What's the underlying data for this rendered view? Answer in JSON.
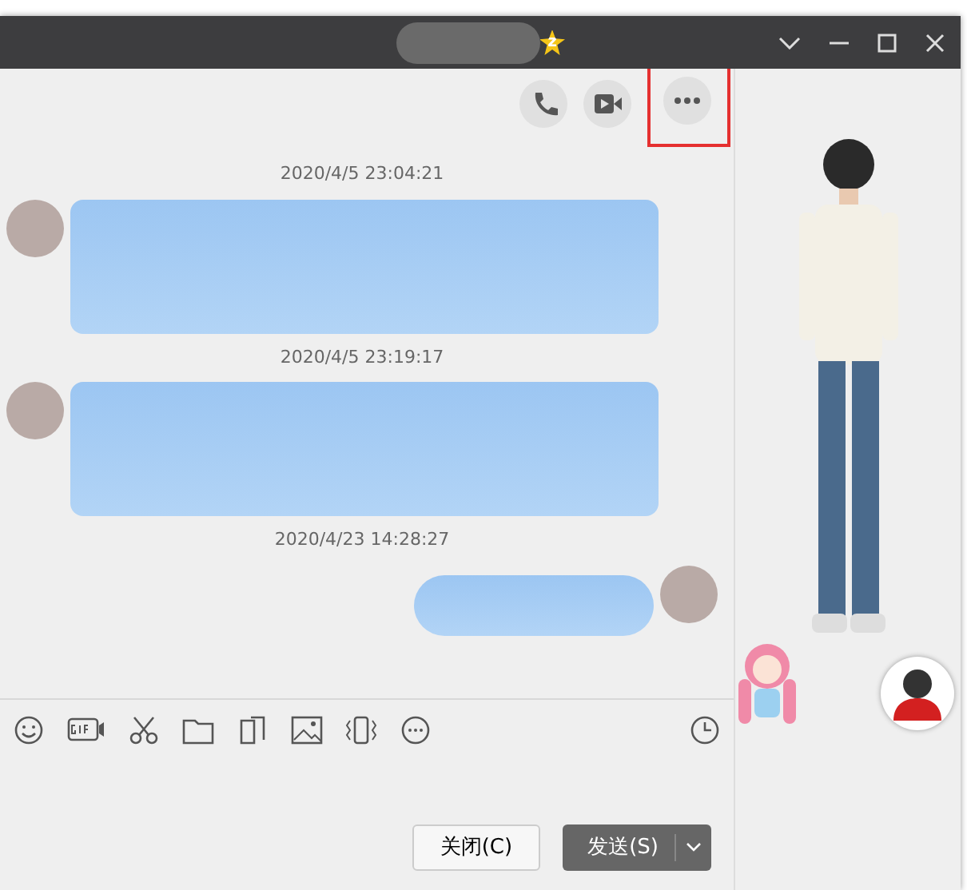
{
  "window": {
    "title_redacted": true,
    "title_badge": "z"
  },
  "actions": [
    {
      "kind": "call",
      "highlighted": false
    },
    {
      "kind": "video",
      "highlighted": false
    },
    {
      "kind": "more",
      "highlighted": true
    }
  ],
  "messages": [
    {
      "time": "2020/4/5 23:04:21",
      "kind": "received"
    },
    {
      "time": "2020/4/5 23:19:17",
      "kind": "received"
    },
    {
      "time": "2020/4/23 14:28:27",
      "kind": "sent"
    }
  ],
  "toolbar": [
    {
      "kind": "emoji"
    },
    {
      "kind": "gif"
    },
    {
      "kind": "scissors"
    },
    {
      "kind": "folder"
    },
    {
      "kind": "doc"
    },
    {
      "kind": "image"
    },
    {
      "kind": "shake"
    },
    {
      "kind": "more"
    }
  ],
  "buttons": [
    {
      "label": "关闭(C)",
      "kind": "close"
    },
    {
      "label": "发送(S)",
      "kind": "send"
    }
  ]
}
